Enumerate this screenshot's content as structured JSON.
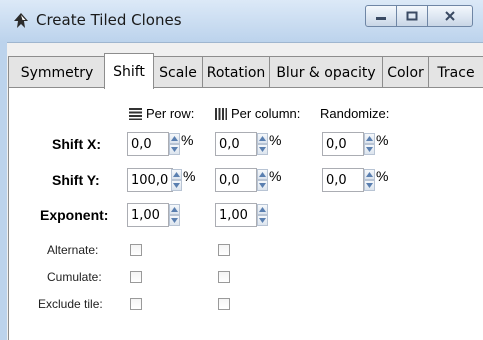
{
  "window": {
    "title": "Create Tiled Clones",
    "controls": {
      "minimize": "minimize",
      "maximize": "maximize",
      "close": "close"
    }
  },
  "tabs": [
    {
      "label": "Symmetry",
      "active": false
    },
    {
      "label": "Shift",
      "active": true
    },
    {
      "label": "Scale",
      "active": false
    },
    {
      "label": "Rotation",
      "active": false
    },
    {
      "label": "Blur & opacity",
      "active": false
    },
    {
      "label": "Color",
      "active": false
    },
    {
      "label": "Trace",
      "active": false
    }
  ],
  "columns": {
    "per_row": "Per row:",
    "per_column": "Per column:",
    "randomize": "Randomize:"
  },
  "rows": {
    "shift_x": {
      "label": "Shift X:",
      "per_row": "0,0",
      "per_column": "0,0",
      "randomize": "0,0",
      "unit": "%"
    },
    "shift_y": {
      "label": "Shift Y:",
      "per_row": "100,0",
      "per_column": "0,0",
      "randomize": "0,0",
      "unit": "%"
    },
    "exponent": {
      "label": "Exponent:",
      "per_row": "1,00",
      "per_column": "1,00"
    },
    "alternate": {
      "label": "Alternate:",
      "per_row_checked": false,
      "per_column_checked": false
    },
    "cumulate": {
      "label": "Cumulate:",
      "per_row_checked": false,
      "per_column_checked": false
    },
    "exclude_tile": {
      "label": "Exclude tile:",
      "per_row_checked": false,
      "per_column_checked": false
    }
  },
  "icons": {
    "app": "inkscape-icon",
    "per_row": "rows-icon",
    "per_column": "columns-icon"
  }
}
